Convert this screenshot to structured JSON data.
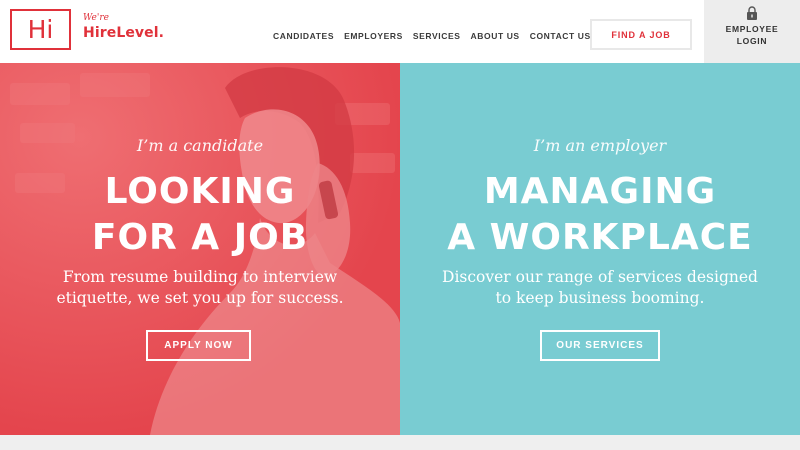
{
  "brand": {
    "logo_mark": "Hi",
    "tagline_prefix": "We're",
    "name": "HireLevel."
  },
  "nav": {
    "items": [
      "CANDIDATES",
      "EMPLOYERS",
      "SERVICES",
      "ABOUT US",
      "CONTACT US"
    ]
  },
  "header": {
    "find_job_label": "FIND A JOB",
    "login_label": "EMPLOYEE LOGIN",
    "login_icon": "lock-icon"
  },
  "hero": {
    "candidate": {
      "eyebrow": "I’m a candidate",
      "headline_line1": "LOOKING",
      "headline_line2": "FOR A JOB",
      "description_line1": "From resume building to interview",
      "description_line2": "etiquette, we set you up for success.",
      "cta_label": "APPLY NOW"
    },
    "employer": {
      "eyebrow": "I’m an employer",
      "headline_line1": "MANAGING",
      "headline_line2": "A WORKPLACE",
      "description_line1": "Discover our range of services designed",
      "description_line2": "to keep business booming.",
      "cta_label": "OUR SERVICES"
    }
  },
  "colors": {
    "brand_red": "#e0313a",
    "candidate_panel": "#e54a52",
    "employer_panel": "#79ccd2"
  }
}
